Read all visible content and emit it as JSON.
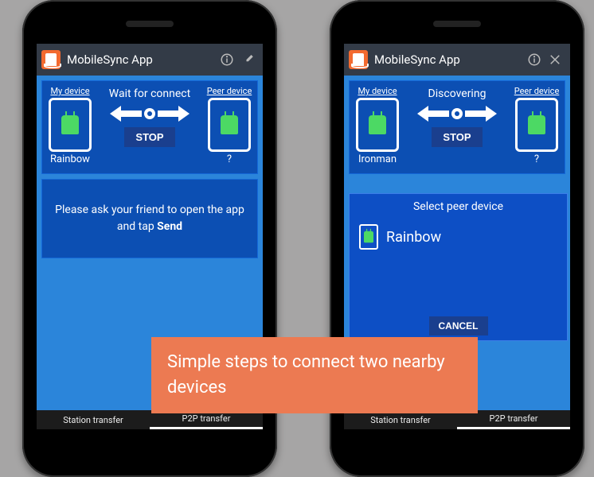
{
  "app_title": "MobileSync App",
  "banner": "Simple steps to connect two nearby devices",
  "phones": {
    "left": {
      "my_label": "My device",
      "peer_label": "Peer device",
      "my_name": "Rainbow",
      "peer_name": "?",
      "status": "Wait for connect",
      "stop": "STOP",
      "message_pre": "Please ask your friend to open the app and tap ",
      "message_bold": "Send",
      "tabs": {
        "station": "Station transfer",
        "p2p": "P2P transfer"
      }
    },
    "right": {
      "my_label": "My device",
      "peer_label": "Peer device",
      "my_name": "Ironman",
      "peer_name": "?",
      "status": "Discovering",
      "stop": "STOP",
      "dialog": {
        "title": "Select peer device",
        "peer": "Rainbow",
        "cancel": "CANCEL"
      },
      "tabs": {
        "station": "Station transfer",
        "p2p": "P2P transfer"
      }
    }
  },
  "icons": {
    "info": "ⓘ",
    "settings": "✕"
  }
}
